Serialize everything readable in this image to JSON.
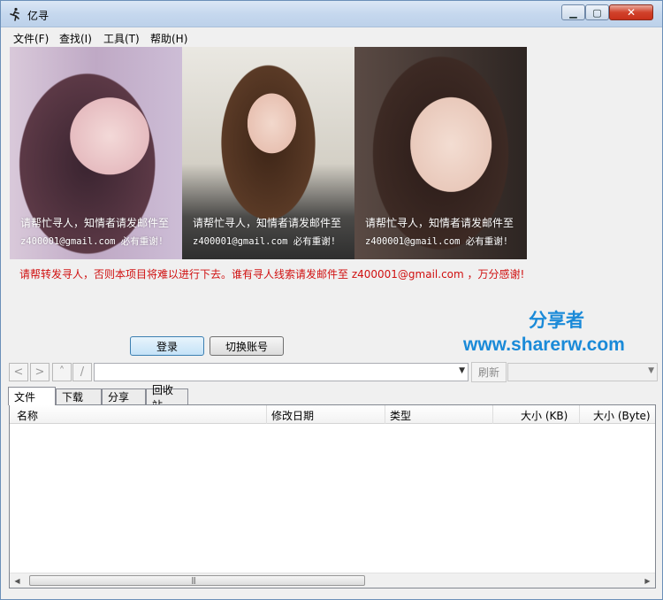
{
  "window": {
    "title": "亿寻"
  },
  "menu": [
    {
      "label": "文件(F)"
    },
    {
      "label": "查找(I)"
    },
    {
      "label": "工具(T)"
    },
    {
      "label": "帮助(H)"
    }
  ],
  "banner": {
    "photos": [
      {
        "caption": "请帮忙寻人，知情者请发邮件至",
        "email": "z400001@gmail.com 必有重谢!"
      },
      {
        "caption": "请帮忙寻人，知情者请发邮件至",
        "email": "z400001@gmail.com 必有重谢!"
      },
      {
        "caption": "请帮忙寻人，知情者请发邮件至",
        "email": "z400001@gmail.com 必有重谢!"
      }
    ],
    "notice": "请帮转发寻人，否则本项目将难以进行下去。谁有寻人线索请发邮件至 z400001@gmail.com ，万分感谢!",
    "watermark_cn": "分享者",
    "watermark_url": "www.sharerw.com",
    "colors": {
      "notice": "#d01010",
      "watermark": "#1a8ad8"
    }
  },
  "buttons": {
    "login": "登录",
    "switch_account": "切换账号"
  },
  "navbar": {
    "back": "<",
    "forward": ">",
    "up": "˄",
    "root": "/",
    "path_value": "",
    "refresh": "刷新"
  },
  "tabs": [
    "文件",
    "下载",
    "分享",
    "回收站"
  ],
  "list": {
    "columns": [
      "名称",
      "修改日期",
      "类型",
      "大小 (KB)",
      "大小 (Byte)"
    ]
  }
}
